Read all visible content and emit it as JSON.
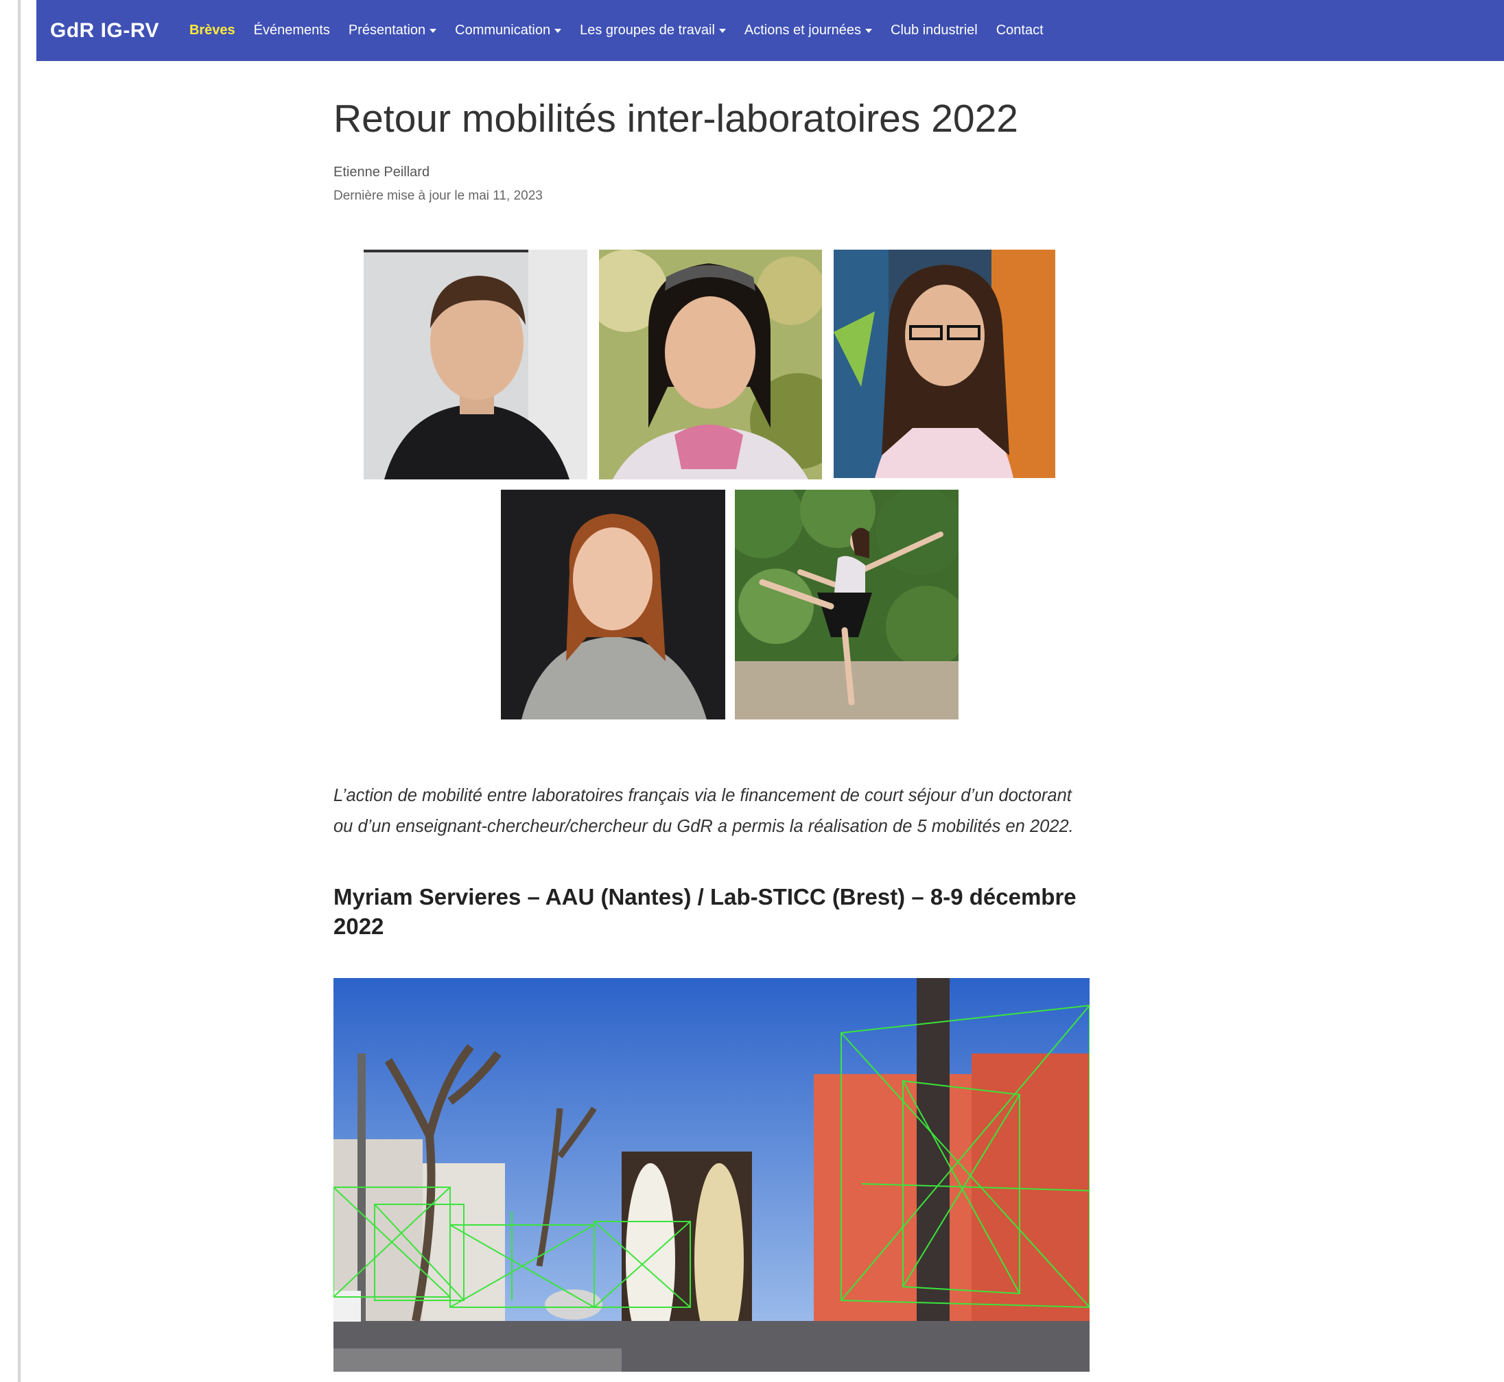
{
  "navbar": {
    "brand": "GdR IG-RV",
    "items": [
      {
        "label": "Brèves",
        "active": true,
        "dropdown": false
      },
      {
        "label": "Événements",
        "active": false,
        "dropdown": false
      },
      {
        "label": "Présentation",
        "active": false,
        "dropdown": true
      },
      {
        "label": "Communication",
        "active": false,
        "dropdown": true
      },
      {
        "label": "Les groupes de travail",
        "active": false,
        "dropdown": true
      },
      {
        "label": "Actions et journées",
        "active": false,
        "dropdown": true
      },
      {
        "label": "Club industriel",
        "active": false,
        "dropdown": false
      },
      {
        "label": "Contact",
        "active": false,
        "dropdown": false
      }
    ],
    "colors": {
      "background": "#3f51b5",
      "active": "#ffeb3b"
    }
  },
  "article": {
    "title": "Retour mobilités inter-laboratoires 2022",
    "author": "Etienne Peillard",
    "updated": "Dernière mise à jour le mai 11, 2023",
    "lead": "L’action de mobilité entre laboratoires français via le financement de court séjour d’un doctorant ou d’un enseignant-chercheur/chercheur du GdR a permis la réalisation de 5 mobilités en 2022.",
    "section_heading": "Myriam Servieres – AAU (Nantes) / Lab-STICC (Brest) – 8-9 décembre 2022"
  }
}
